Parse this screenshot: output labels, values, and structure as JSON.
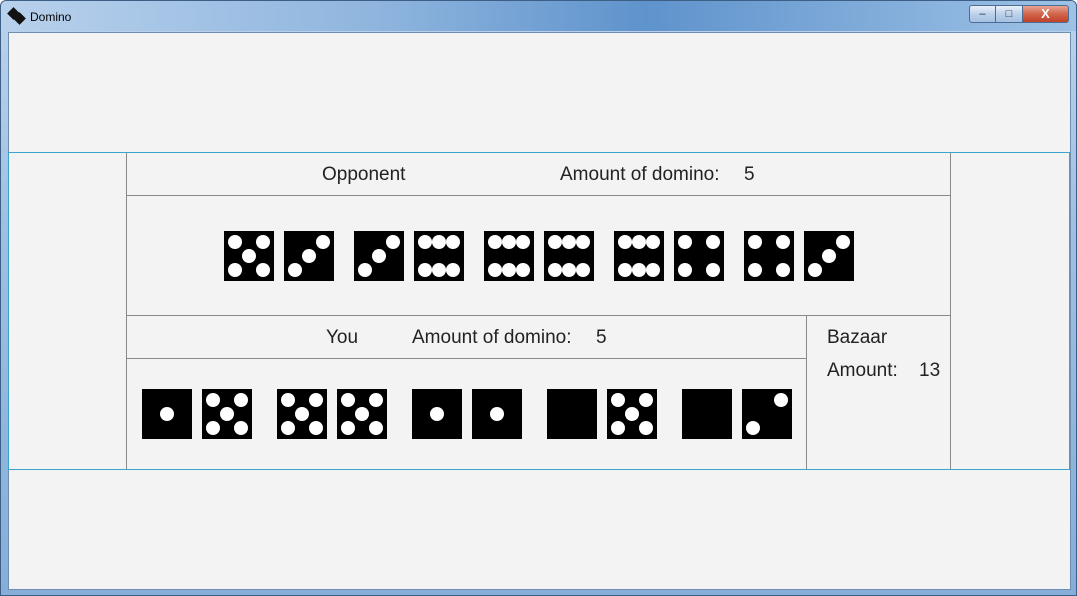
{
  "window": {
    "title": "Domino",
    "controls": {
      "minimize": "–",
      "maximize": "□",
      "close": "X"
    }
  },
  "opponent": {
    "title": "Opponent",
    "amount_label": "Amount of domino:",
    "amount_value": "5",
    "dice": [
      5,
      3,
      3,
      6,
      6,
      6,
      6,
      4,
      4,
      3
    ]
  },
  "you": {
    "title": "You",
    "amount_label": "Amount of domino:",
    "amount_value": "5",
    "dice": [
      1,
      5,
      5,
      5,
      1,
      1,
      0,
      5,
      0,
      2
    ]
  },
  "bazaar": {
    "title": "Bazaar",
    "amount_label": "Amount:",
    "amount_value": "13"
  }
}
